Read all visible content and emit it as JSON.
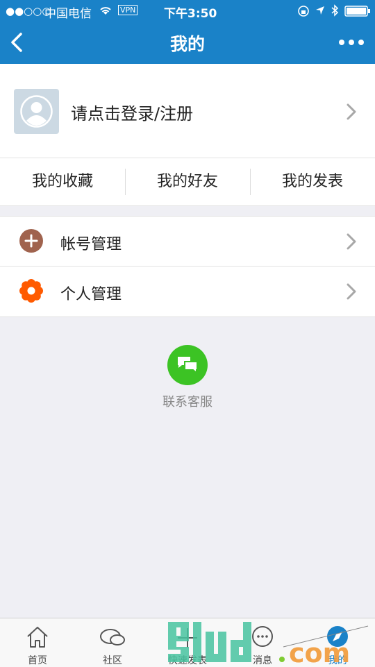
{
  "status_bar": {
    "signal": "●●○○○",
    "carrier": "中国电信",
    "vpn": "VPN",
    "time": "下午3:50"
  },
  "nav": {
    "title": "我的"
  },
  "profile": {
    "login_text": "请点击登录/注册"
  },
  "quick_links": [
    "我的收藏",
    "我的好友",
    "我的发表"
  ],
  "menu": [
    {
      "label": "帐号管理",
      "icon": "plus-circle-icon",
      "color": "#a0634e"
    },
    {
      "label": "个人管理",
      "icon": "flower-gear-icon",
      "color": "#ff5a00"
    }
  ],
  "service": {
    "label": "联系客服",
    "color": "#3cc324"
  },
  "tabs": [
    {
      "label": "首页",
      "icon": "home-icon"
    },
    {
      "label": "社区",
      "icon": "chat-bubbles-icon"
    },
    {
      "label": "快速发表",
      "icon": "plus-icon"
    },
    {
      "label": "消息",
      "icon": "message-icon"
    },
    {
      "label": "我的",
      "icon": "compass-icon",
      "active": true
    }
  ],
  "theme": {
    "primary": "#1a82c8",
    "background": "#efeff4"
  }
}
